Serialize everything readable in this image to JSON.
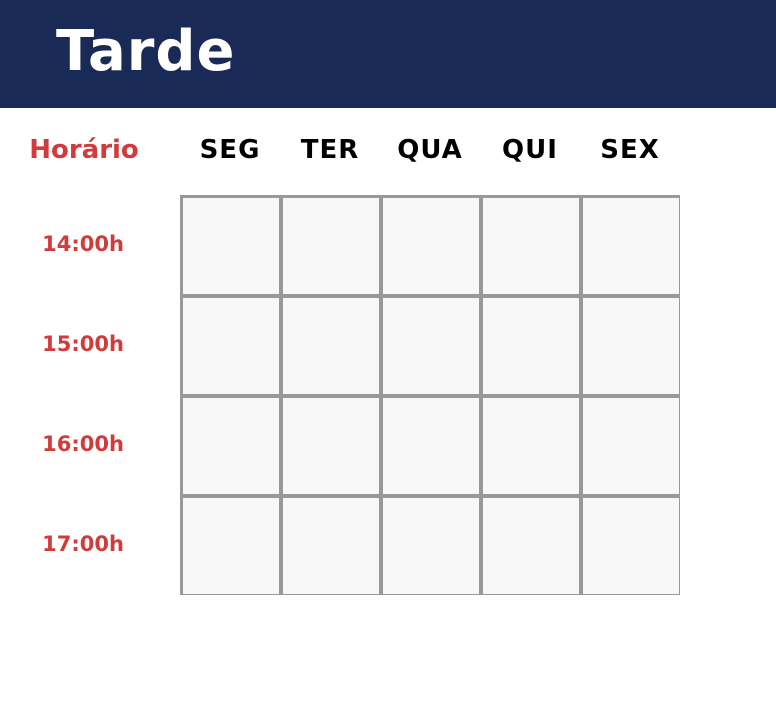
{
  "header": {
    "title": "Tarde",
    "background": "#182a55"
  },
  "schedule": {
    "row_label_header": "Horário",
    "days": [
      "SEG",
      "TER",
      "QUA",
      "QUI",
      "SEX"
    ],
    "times": [
      "14:00h",
      "15:00h",
      "16:00h",
      "17:00h"
    ],
    "cells": [
      [
        "",
        "",
        "",
        "",
        ""
      ],
      [
        "",
        "",
        "",
        "",
        ""
      ],
      [
        "",
        "",
        "",
        "",
        ""
      ],
      [
        "",
        "",
        "",
        "",
        ""
      ]
    ]
  },
  "colors": {
    "accent_red": "#d13b3b",
    "grid_line": "#999999",
    "cell_fill": "#f8f8f8"
  }
}
